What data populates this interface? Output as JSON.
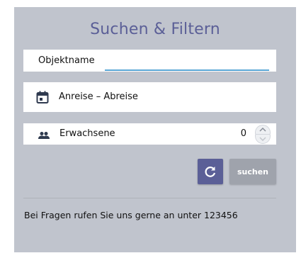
{
  "form": {
    "title": "Suchen & Filtern",
    "object_name": {
      "label": "Objektname",
      "value": ""
    },
    "dates": {
      "label": "Anreise – Abreise",
      "icon": "calendar-icon"
    },
    "guests": {
      "label": "Erwachsene",
      "value": "0",
      "icon": "people-icon"
    },
    "refresh_icon": "refresh-icon",
    "search_label": "suchen",
    "footer_text": "Bei Fragen rufen Sie uns gerne an unter 123456"
  },
  "colors": {
    "panel": "#c0c4cd",
    "accent": "#5b5f97",
    "input_underline": "#5aa7d6",
    "search_button": "#9fa3ac"
  }
}
